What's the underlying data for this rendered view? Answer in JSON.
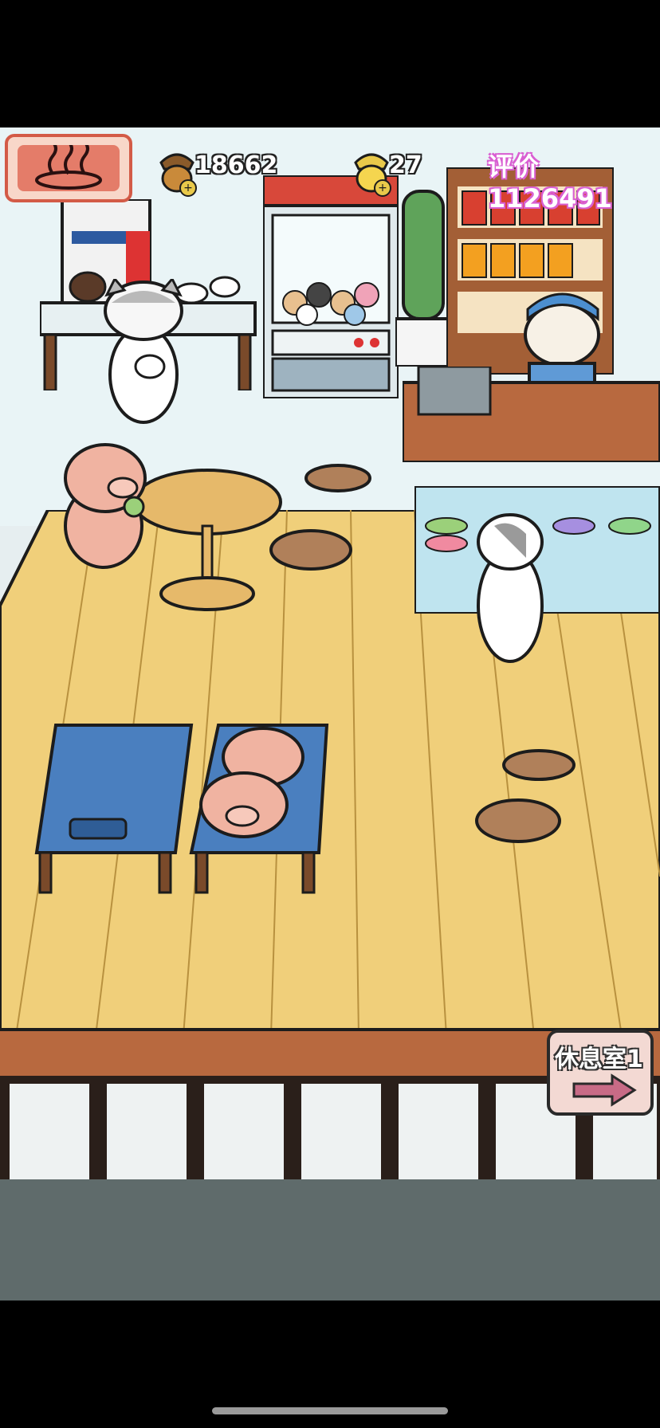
{
  "hud": {
    "acorn_count": "18662",
    "gold_acorn_count": "27",
    "rating_label": "评价 1126491"
  },
  "navigation": {
    "next_room_label": "休息室1"
  },
  "colors": {
    "floor": "#f0cf7a",
    "floor_lines": "#b38a3a",
    "bath_button": "#e47c69",
    "rating_text": "#d95fd2",
    "mat": "#4a7fbf"
  },
  "icons": {
    "bath": "hot-spring-icon",
    "acorn": "acorn-icon",
    "gold_acorn": "gold-acorn-icon",
    "add": "plus-icon",
    "arrow": "arrow-right-icon"
  }
}
